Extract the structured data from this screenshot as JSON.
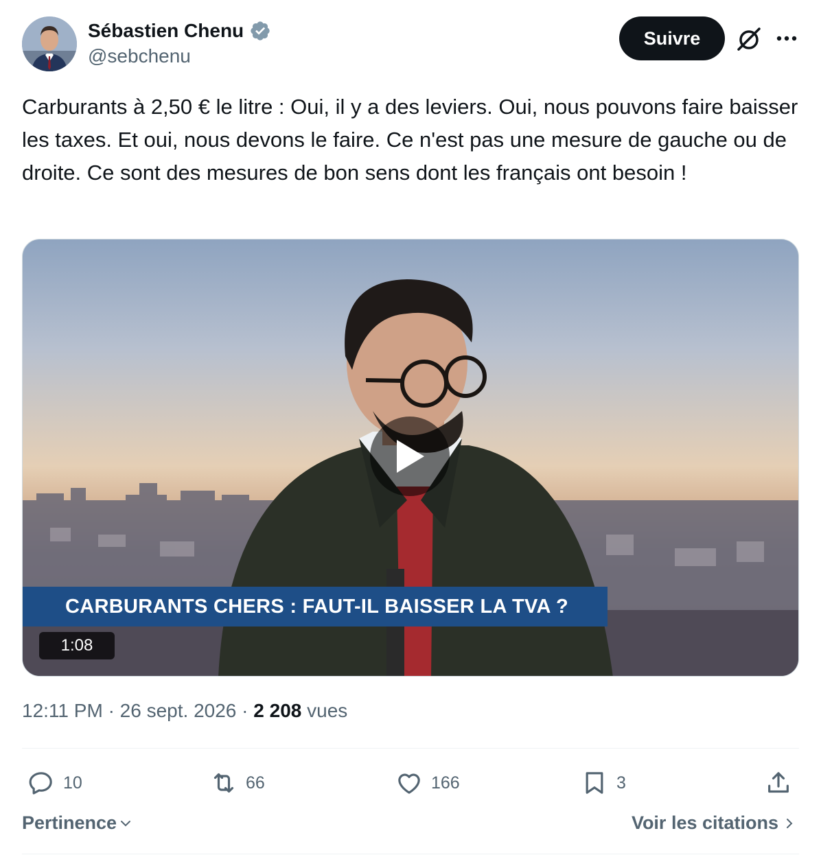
{
  "author": {
    "name": "Sébastien Chenu",
    "handle": "@sebchenu",
    "verified": true
  },
  "header": {
    "follow_label": "Suivre",
    "grok_icon": "grok-slash-icon",
    "more_icon": "more-dots-icon"
  },
  "tweet": {
    "text": "Carburants à 2,50 € le litre : Oui, il y a des leviers. Oui, nous pouvons faire baisser les taxes. Et oui, nous devons le faire. Ce n'est pas une mesure de gauche ou de droite. Ce sont des mesures de bon sens dont les français ont besoin !"
  },
  "media": {
    "chyron": "CARBURANTS CHERS : FAUT-IL BAISSER LA TVA ?",
    "duration": "1:08"
  },
  "meta": {
    "time": "12:11 PM",
    "separator": "·",
    "date": "26 sept. 2026",
    "views_count": "2 208",
    "views_label": "vues"
  },
  "actions": {
    "replies": "10",
    "reposts": "66",
    "likes": "166",
    "bookmarks": "3"
  },
  "footer": {
    "sort_label": "Pertinence",
    "quotes_label": "Voir les citations"
  },
  "colors": {
    "text_primary": "#0f1419",
    "text_secondary": "#536471",
    "verified": "#829aab",
    "chyron_bg": "#1e4e87"
  }
}
